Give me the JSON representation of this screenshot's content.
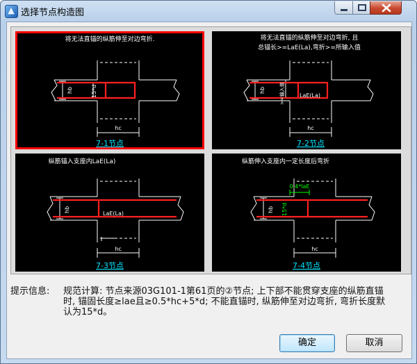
{
  "window": {
    "title": "选择节点构造图"
  },
  "panels": [
    {
      "id": "7-1",
      "top_text": "将无法直锚的纵筋伸至对边弯折.",
      "top_text_2": "",
      "dims": [
        "hb",
        "15*d",
        "hc"
      ],
      "caption": "7-1节点",
      "selected": true
    },
    {
      "id": "7-2",
      "top_text": "将无法直锚的纵筋伸至对边弯折, 且",
      "top_text_2": "总锚长>=LaE(La),弯折>=所输入值",
      "dims": [
        "hb",
        ">=输入值",
        "LaE(La)",
        "hc"
      ],
      "caption": "7-2节点",
      "selected": false
    },
    {
      "id": "7-3",
      "top_text": "纵筋锚入支座内LaE(La)",
      "top_text_2": "",
      "dims": [
        "hb",
        "LaE(La)",
        "hc"
      ],
      "caption": "7-3节点",
      "selected": false
    },
    {
      "id": "7-4",
      "top_text": "纵筋伸入支座内一定长度后弯折",
      "top_text_2": "",
      "dims": [
        "0.4*laE",
        "15*d",
        "hb",
        "hc"
      ],
      "caption": "7-4节点",
      "selected": false
    }
  ],
  "info": {
    "label": "提示信息:",
    "line1": "规范计算: 节点来源03G101-1第61页的②节点; 上下部不能贯穿支座的纵筋直锚",
    "line2": "时, 锚固长度≥lae且≥0.5*hc+5*d; 不能直锚时, 纵筋伸至对边弯折, 弯折长度默",
    "line3": "认为15*d。"
  },
  "buttons": {
    "ok": "确定",
    "cancel": "取消"
  },
  "colors": {
    "rebar": "#ff2020",
    "caption": "#00e5ff",
    "panel_bg": "#000000",
    "highlight": "#00ff00",
    "selection": "#ff0000"
  }
}
